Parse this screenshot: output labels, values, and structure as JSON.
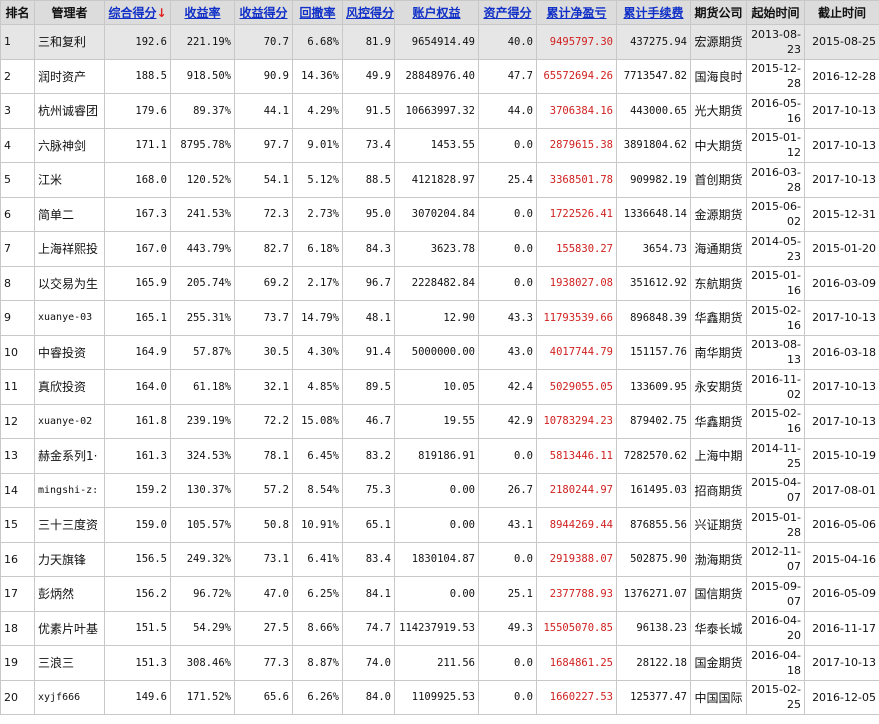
{
  "headers": {
    "rank": "排名",
    "manager": "管理者",
    "total_score": "综合得分",
    "return_rate": "收益率",
    "return_score": "收益得分",
    "drawdown": "回撤率",
    "risk_score": "风控得分",
    "equity": "账户权益",
    "asset_score": "资产得分",
    "net_profit": "累计净盈亏",
    "fees": "累计手续费",
    "broker": "期货公司",
    "start": "起始时间",
    "end": "截止时间"
  },
  "sort_arrow": "↓",
  "colors": {
    "header_bg": "#dcdcdc",
    "link": "#1030c8",
    "profit": "#d02020",
    "highlight_row": "#e6e6e6"
  },
  "rows": [
    {
      "rank": "1",
      "manager": "三和复利",
      "total_score": "192.6",
      "return_rate": "221.19%",
      "return_score": "70.7",
      "drawdown": "6.68%",
      "risk_score": "81.9",
      "equity": "9654914.49",
      "asset_score": "40.0",
      "net_profit": "9495797.30",
      "fees": "437275.94",
      "broker": "宏源期货",
      "start": "2013-08-23",
      "end": "2015-08-25"
    },
    {
      "rank": "2",
      "manager": "润时资产",
      "total_score": "188.5",
      "return_rate": "918.50%",
      "return_score": "90.9",
      "drawdown": "14.36%",
      "risk_score": "49.9",
      "equity": "28848976.40",
      "asset_score": "47.7",
      "net_profit": "65572694.26",
      "fees": "7713547.82",
      "broker": "国海良时",
      "start": "2015-12-28",
      "end": "2016-12-28"
    },
    {
      "rank": "3",
      "manager": "杭州诚睿团",
      "total_score": "179.6",
      "return_rate": "89.37%",
      "return_score": "44.1",
      "drawdown": "4.29%",
      "risk_score": "91.5",
      "equity": "10663997.32",
      "asset_score": "44.0",
      "net_profit": "3706384.16",
      "fees": "443000.65",
      "broker": "光大期货",
      "start": "2016-05-16",
      "end": "2017-10-13"
    },
    {
      "rank": "4",
      "manager": "六脉神剑",
      "total_score": "171.1",
      "return_rate": "8795.78%",
      "return_score": "97.7",
      "drawdown": "9.01%",
      "risk_score": "73.4",
      "equity": "1453.55",
      "asset_score": "0.0",
      "net_profit": "2879615.38",
      "fees": "3891804.62",
      "broker": "中大期货",
      "start": "2015-01-12",
      "end": "2017-10-13"
    },
    {
      "rank": "5",
      "manager": "江米",
      "total_score": "168.0",
      "return_rate": "120.52%",
      "return_score": "54.1",
      "drawdown": "5.12%",
      "risk_score": "88.5",
      "equity": "4121828.97",
      "asset_score": "25.4",
      "net_profit": "3368501.78",
      "fees": "909982.19",
      "broker": "首创期货",
      "start": "2016-03-28",
      "end": "2017-10-13"
    },
    {
      "rank": "6",
      "manager": "简单二",
      "total_score": "167.3",
      "return_rate": "241.53%",
      "return_score": "72.3",
      "drawdown": "2.73%",
      "risk_score": "95.0",
      "equity": "3070204.84",
      "asset_score": "0.0",
      "net_profit": "1722526.41",
      "fees": "1336648.14",
      "broker": "金源期货",
      "start": "2015-06-02",
      "end": "2015-12-31"
    },
    {
      "rank": "7",
      "manager": "上海祥熙投",
      "total_score": "167.0",
      "return_rate": "443.79%",
      "return_score": "82.7",
      "drawdown": "6.18%",
      "risk_score": "84.3",
      "equity": "3623.78",
      "asset_score": "0.0",
      "net_profit": "155830.27",
      "fees": "3654.73",
      "broker": "海通期货",
      "start": "2014-05-23",
      "end": "2015-01-20"
    },
    {
      "rank": "8",
      "manager": "以交易为生",
      "total_score": "165.9",
      "return_rate": "205.74%",
      "return_score": "69.2",
      "drawdown": "2.17%",
      "risk_score": "96.7",
      "equity": "2228482.84",
      "asset_score": "0.0",
      "net_profit": "1938027.08",
      "fees": "351612.92",
      "broker": "东航期货",
      "start": "2015-01-16",
      "end": "2016-03-09"
    },
    {
      "rank": "9",
      "manager": "xuanye-03",
      "total_score": "165.1",
      "return_rate": "255.31%",
      "return_score": "73.7",
      "drawdown": "14.79%",
      "risk_score": "48.1",
      "equity": "12.90",
      "asset_score": "43.3",
      "net_profit": "11793539.66",
      "fees": "896848.39",
      "broker": "华鑫期货",
      "start": "2015-02-16",
      "end": "2017-10-13"
    },
    {
      "rank": "10",
      "manager": "中睿投资",
      "total_score": "164.9",
      "return_rate": "57.87%",
      "return_score": "30.5",
      "drawdown": "4.30%",
      "risk_score": "91.4",
      "equity": "5000000.00",
      "asset_score": "43.0",
      "net_profit": "4017744.79",
      "fees": "151157.76",
      "broker": "南华期货",
      "start": "2013-08-13",
      "end": "2016-03-18"
    },
    {
      "rank": "11",
      "manager": "真欣投资",
      "total_score": "164.0",
      "return_rate": "61.18%",
      "return_score": "32.1",
      "drawdown": "4.85%",
      "risk_score": "89.5",
      "equity": "10.05",
      "asset_score": "42.4",
      "net_profit": "5029055.05",
      "fees": "133609.95",
      "broker": "永安期货",
      "start": "2016-11-02",
      "end": "2017-10-13"
    },
    {
      "rank": "12",
      "manager": "xuanye-02",
      "total_score": "161.8",
      "return_rate": "239.19%",
      "return_score": "72.2",
      "drawdown": "15.08%",
      "risk_score": "46.7",
      "equity": "19.55",
      "asset_score": "42.9",
      "net_profit": "10783294.23",
      "fees": "879402.75",
      "broker": "华鑫期货",
      "start": "2015-02-16",
      "end": "2017-10-13"
    },
    {
      "rank": "13",
      "manager": "赫金系列1·",
      "total_score": "161.3",
      "return_rate": "324.53%",
      "return_score": "78.1",
      "drawdown": "6.45%",
      "risk_score": "83.2",
      "equity": "819186.91",
      "asset_score": "0.0",
      "net_profit": "5813446.11",
      "fees": "7282570.62",
      "broker": "上海中期",
      "start": "2014-11-25",
      "end": "2015-10-19"
    },
    {
      "rank": "14",
      "manager": "mingshi-z:",
      "total_score": "159.2",
      "return_rate": "130.37%",
      "return_score": "57.2",
      "drawdown": "8.54%",
      "risk_score": "75.3",
      "equity": "0.00",
      "asset_score": "26.7",
      "net_profit": "2180244.97",
      "fees": "161495.03",
      "broker": "招商期货",
      "start": "2015-04-07",
      "end": "2017-08-01"
    },
    {
      "rank": "15",
      "manager": "三十三度资",
      "total_score": "159.0",
      "return_rate": "105.57%",
      "return_score": "50.8",
      "drawdown": "10.91%",
      "risk_score": "65.1",
      "equity": "0.00",
      "asset_score": "43.1",
      "net_profit": "8944269.44",
      "fees": "876855.56",
      "broker": "兴证期货",
      "start": "2015-01-28",
      "end": "2016-05-06"
    },
    {
      "rank": "16",
      "manager": "力天旗锋",
      "total_score": "156.5",
      "return_rate": "249.32%",
      "return_score": "73.1",
      "drawdown": "6.41%",
      "risk_score": "83.4",
      "equity": "1830104.87",
      "asset_score": "0.0",
      "net_profit": "2919388.07",
      "fees": "502875.90",
      "broker": "渤海期货",
      "start": "2012-11-07",
      "end": "2015-04-16"
    },
    {
      "rank": "17",
      "manager": "彭炳然",
      "total_score": "156.2",
      "return_rate": "96.72%",
      "return_score": "47.0",
      "drawdown": "6.25%",
      "risk_score": "84.1",
      "equity": "0.00",
      "asset_score": "25.1",
      "net_profit": "2377788.93",
      "fees": "1376271.07",
      "broker": "国信期货",
      "start": "2015-09-07",
      "end": "2016-05-09"
    },
    {
      "rank": "18",
      "manager": "优素片叶基",
      "total_score": "151.5",
      "return_rate": "54.29%",
      "return_score": "27.5",
      "drawdown": "8.66%",
      "risk_score": "74.7",
      "equity": "114237919.53",
      "asset_score": "49.3",
      "net_profit": "15505070.85",
      "fees": "96138.23",
      "broker": "华泰长城",
      "start": "2016-04-20",
      "end": "2016-11-17"
    },
    {
      "rank": "19",
      "manager": "三浪三",
      "total_score": "151.3",
      "return_rate": "308.46%",
      "return_score": "77.3",
      "drawdown": "8.87%",
      "risk_score": "74.0",
      "equity": "211.56",
      "asset_score": "0.0",
      "net_profit": "1684861.25",
      "fees": "28122.18",
      "broker": "国金期货",
      "start": "2016-04-18",
      "end": "2017-10-13"
    },
    {
      "rank": "20",
      "manager": "xyjf666",
      "total_score": "149.6",
      "return_rate": "171.52%",
      "return_score": "65.6",
      "drawdown": "6.26%",
      "risk_score": "84.0",
      "equity": "1109925.53",
      "asset_score": "0.0",
      "net_profit": "1660227.53",
      "fees": "125377.47",
      "broker": "中国国际",
      "start": "2015-02-25",
      "end": "2016-12-05"
    }
  ]
}
